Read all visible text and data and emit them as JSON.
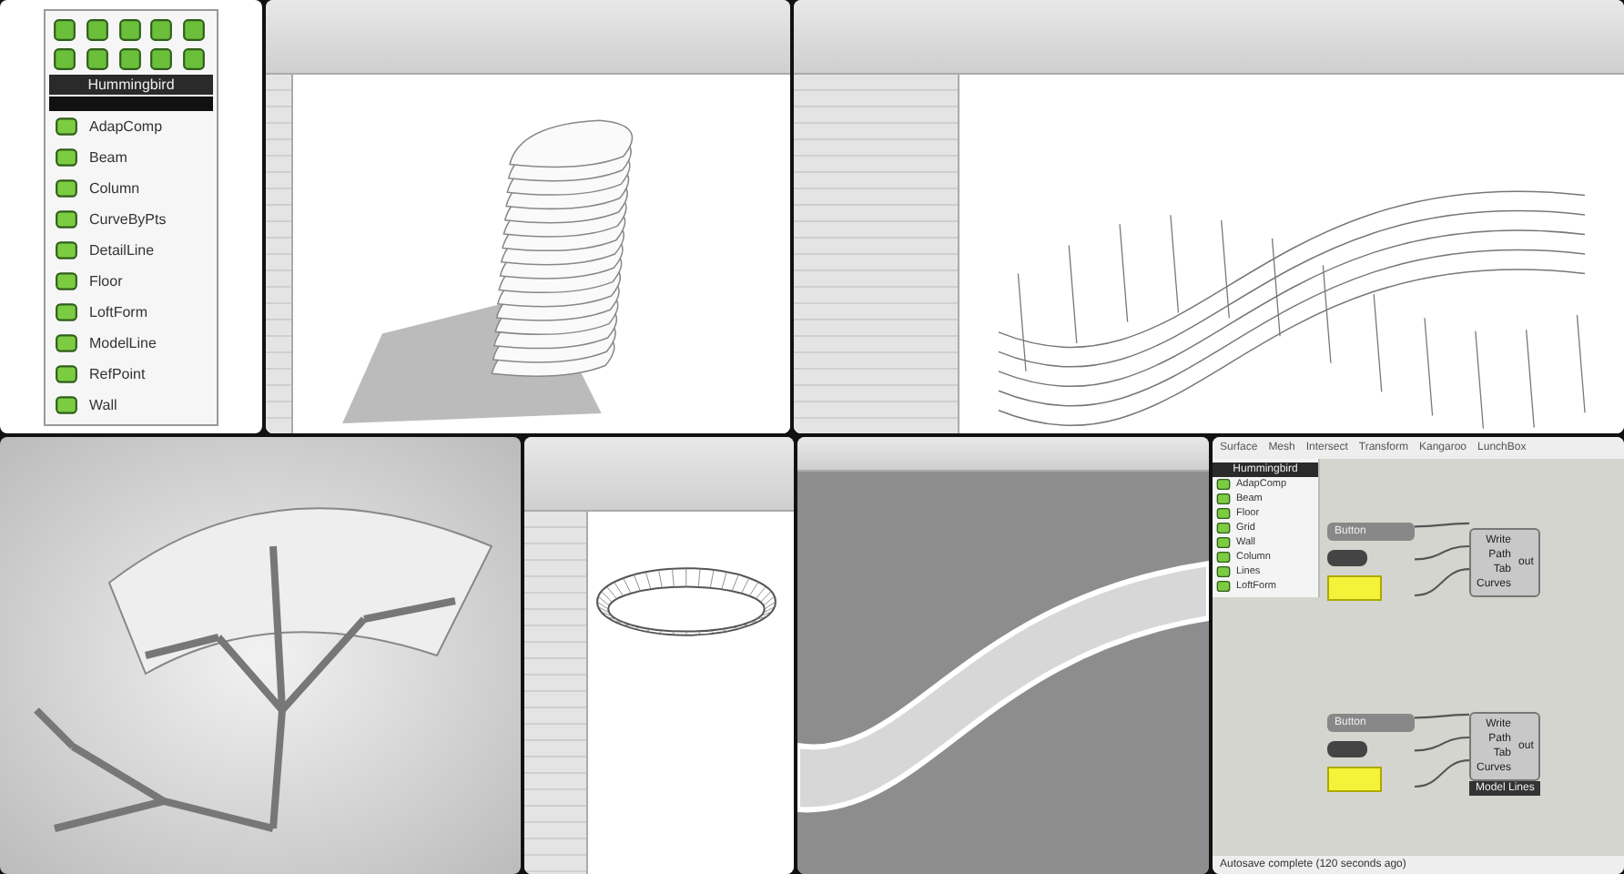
{
  "hummingbird_menu": {
    "header": "Hummingbird",
    "items": [
      {
        "label": "AdapComp"
      },
      {
        "label": "Beam"
      },
      {
        "label": "Column"
      },
      {
        "label": "CurveByPts"
      },
      {
        "label": "DetailLine"
      },
      {
        "label": "Floor"
      },
      {
        "label": "LoftForm"
      },
      {
        "label": "ModelLine"
      },
      {
        "label": "RefPoint"
      },
      {
        "label": "Wall"
      }
    ]
  },
  "grasshopper": {
    "menu_bar": [
      "Surface",
      "Mesh",
      "Intersect",
      "Transform",
      "Kangaroo",
      "LunchBox"
    ],
    "palette": {
      "header": "Hummingbird",
      "items": [
        {
          "label": "AdapComp"
        },
        {
          "label": "Beam"
        },
        {
          "label": "Floor"
        },
        {
          "label": "Grid"
        },
        {
          "label": "Wall"
        },
        {
          "label": "Column"
        },
        {
          "label": "Lines"
        },
        {
          "label": "LoftForm"
        }
      ]
    },
    "groups": [
      {
        "button": "Button",
        "inputs": [
          "Write",
          "Path",
          "Tab",
          "Curves"
        ],
        "output": "out"
      },
      {
        "button": "Button",
        "inputs": [
          "Write",
          "Path",
          "Tab",
          "Curves"
        ],
        "output": "out",
        "caption": "Model Lines"
      }
    ],
    "status": "Autosave complete (120 seconds ago)"
  }
}
